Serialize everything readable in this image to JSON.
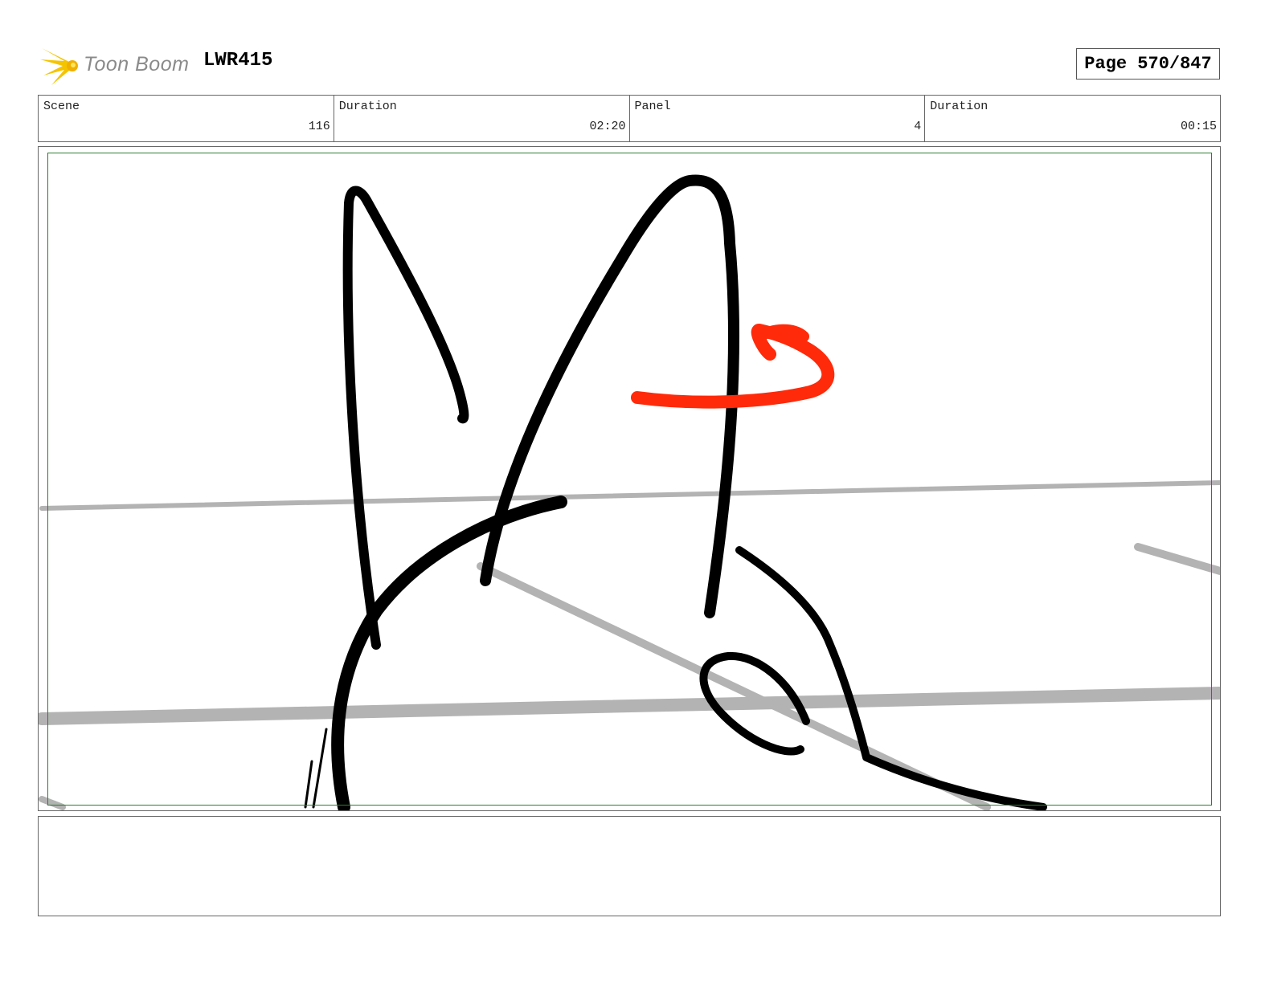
{
  "header": {
    "logo_text": "Toon Boom",
    "project_id": "LWR415",
    "page_label": "Page 570/847"
  },
  "info": {
    "scene_label": "Scene",
    "scene_value": "116",
    "scene_duration_label": "Duration",
    "scene_duration_value": "02:20",
    "panel_label": "Panel",
    "panel_value": "4",
    "panel_duration_label": "Duration",
    "panel_duration_value": "00:15"
  },
  "colors": {
    "ink": "#000000",
    "accent_arrow": "#ff2a0a",
    "guide_gray": "#b3b3b3",
    "safe_frame": "#2e7d32",
    "logo_yellow": "#f5c400"
  },
  "icons": {
    "logo": "toon-boom-star-icon"
  },
  "notes": {
    "text": ""
  }
}
